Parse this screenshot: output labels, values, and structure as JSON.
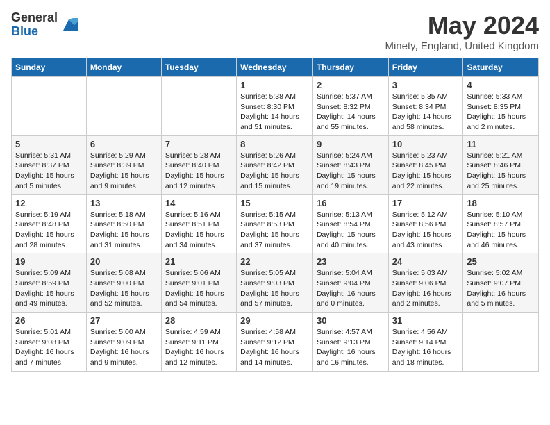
{
  "header": {
    "logo_general": "General",
    "logo_blue": "Blue",
    "month_year": "May 2024",
    "location": "Minety, England, United Kingdom"
  },
  "weekdays": [
    "Sunday",
    "Monday",
    "Tuesday",
    "Wednesday",
    "Thursday",
    "Friday",
    "Saturday"
  ],
  "weeks": [
    [
      {
        "num": "",
        "info": ""
      },
      {
        "num": "",
        "info": ""
      },
      {
        "num": "",
        "info": ""
      },
      {
        "num": "1",
        "info": "Sunrise: 5:38 AM\nSunset: 8:30 PM\nDaylight: 14 hours\nand 51 minutes."
      },
      {
        "num": "2",
        "info": "Sunrise: 5:37 AM\nSunset: 8:32 PM\nDaylight: 14 hours\nand 55 minutes."
      },
      {
        "num": "3",
        "info": "Sunrise: 5:35 AM\nSunset: 8:34 PM\nDaylight: 14 hours\nand 58 minutes."
      },
      {
        "num": "4",
        "info": "Sunrise: 5:33 AM\nSunset: 8:35 PM\nDaylight: 15 hours\nand 2 minutes."
      }
    ],
    [
      {
        "num": "5",
        "info": "Sunrise: 5:31 AM\nSunset: 8:37 PM\nDaylight: 15 hours\nand 5 minutes."
      },
      {
        "num": "6",
        "info": "Sunrise: 5:29 AM\nSunset: 8:39 PM\nDaylight: 15 hours\nand 9 minutes."
      },
      {
        "num": "7",
        "info": "Sunrise: 5:28 AM\nSunset: 8:40 PM\nDaylight: 15 hours\nand 12 minutes."
      },
      {
        "num": "8",
        "info": "Sunrise: 5:26 AM\nSunset: 8:42 PM\nDaylight: 15 hours\nand 15 minutes."
      },
      {
        "num": "9",
        "info": "Sunrise: 5:24 AM\nSunset: 8:43 PM\nDaylight: 15 hours\nand 19 minutes."
      },
      {
        "num": "10",
        "info": "Sunrise: 5:23 AM\nSunset: 8:45 PM\nDaylight: 15 hours\nand 22 minutes."
      },
      {
        "num": "11",
        "info": "Sunrise: 5:21 AM\nSunset: 8:46 PM\nDaylight: 15 hours\nand 25 minutes."
      }
    ],
    [
      {
        "num": "12",
        "info": "Sunrise: 5:19 AM\nSunset: 8:48 PM\nDaylight: 15 hours\nand 28 minutes."
      },
      {
        "num": "13",
        "info": "Sunrise: 5:18 AM\nSunset: 8:50 PM\nDaylight: 15 hours\nand 31 minutes."
      },
      {
        "num": "14",
        "info": "Sunrise: 5:16 AM\nSunset: 8:51 PM\nDaylight: 15 hours\nand 34 minutes."
      },
      {
        "num": "15",
        "info": "Sunrise: 5:15 AM\nSunset: 8:53 PM\nDaylight: 15 hours\nand 37 minutes."
      },
      {
        "num": "16",
        "info": "Sunrise: 5:13 AM\nSunset: 8:54 PM\nDaylight: 15 hours\nand 40 minutes."
      },
      {
        "num": "17",
        "info": "Sunrise: 5:12 AM\nSunset: 8:56 PM\nDaylight: 15 hours\nand 43 minutes."
      },
      {
        "num": "18",
        "info": "Sunrise: 5:10 AM\nSunset: 8:57 PM\nDaylight: 15 hours\nand 46 minutes."
      }
    ],
    [
      {
        "num": "19",
        "info": "Sunrise: 5:09 AM\nSunset: 8:59 PM\nDaylight: 15 hours\nand 49 minutes."
      },
      {
        "num": "20",
        "info": "Sunrise: 5:08 AM\nSunset: 9:00 PM\nDaylight: 15 hours\nand 52 minutes."
      },
      {
        "num": "21",
        "info": "Sunrise: 5:06 AM\nSunset: 9:01 PM\nDaylight: 15 hours\nand 54 minutes."
      },
      {
        "num": "22",
        "info": "Sunrise: 5:05 AM\nSunset: 9:03 PM\nDaylight: 15 hours\nand 57 minutes."
      },
      {
        "num": "23",
        "info": "Sunrise: 5:04 AM\nSunset: 9:04 PM\nDaylight: 16 hours\nand 0 minutes."
      },
      {
        "num": "24",
        "info": "Sunrise: 5:03 AM\nSunset: 9:06 PM\nDaylight: 16 hours\nand 2 minutes."
      },
      {
        "num": "25",
        "info": "Sunrise: 5:02 AM\nSunset: 9:07 PM\nDaylight: 16 hours\nand 5 minutes."
      }
    ],
    [
      {
        "num": "26",
        "info": "Sunrise: 5:01 AM\nSunset: 9:08 PM\nDaylight: 16 hours\nand 7 minutes."
      },
      {
        "num": "27",
        "info": "Sunrise: 5:00 AM\nSunset: 9:09 PM\nDaylight: 16 hours\nand 9 minutes."
      },
      {
        "num": "28",
        "info": "Sunrise: 4:59 AM\nSunset: 9:11 PM\nDaylight: 16 hours\nand 12 minutes."
      },
      {
        "num": "29",
        "info": "Sunrise: 4:58 AM\nSunset: 9:12 PM\nDaylight: 16 hours\nand 14 minutes."
      },
      {
        "num": "30",
        "info": "Sunrise: 4:57 AM\nSunset: 9:13 PM\nDaylight: 16 hours\nand 16 minutes."
      },
      {
        "num": "31",
        "info": "Sunrise: 4:56 AM\nSunset: 9:14 PM\nDaylight: 16 hours\nand 18 minutes."
      },
      {
        "num": "",
        "info": ""
      }
    ]
  ]
}
